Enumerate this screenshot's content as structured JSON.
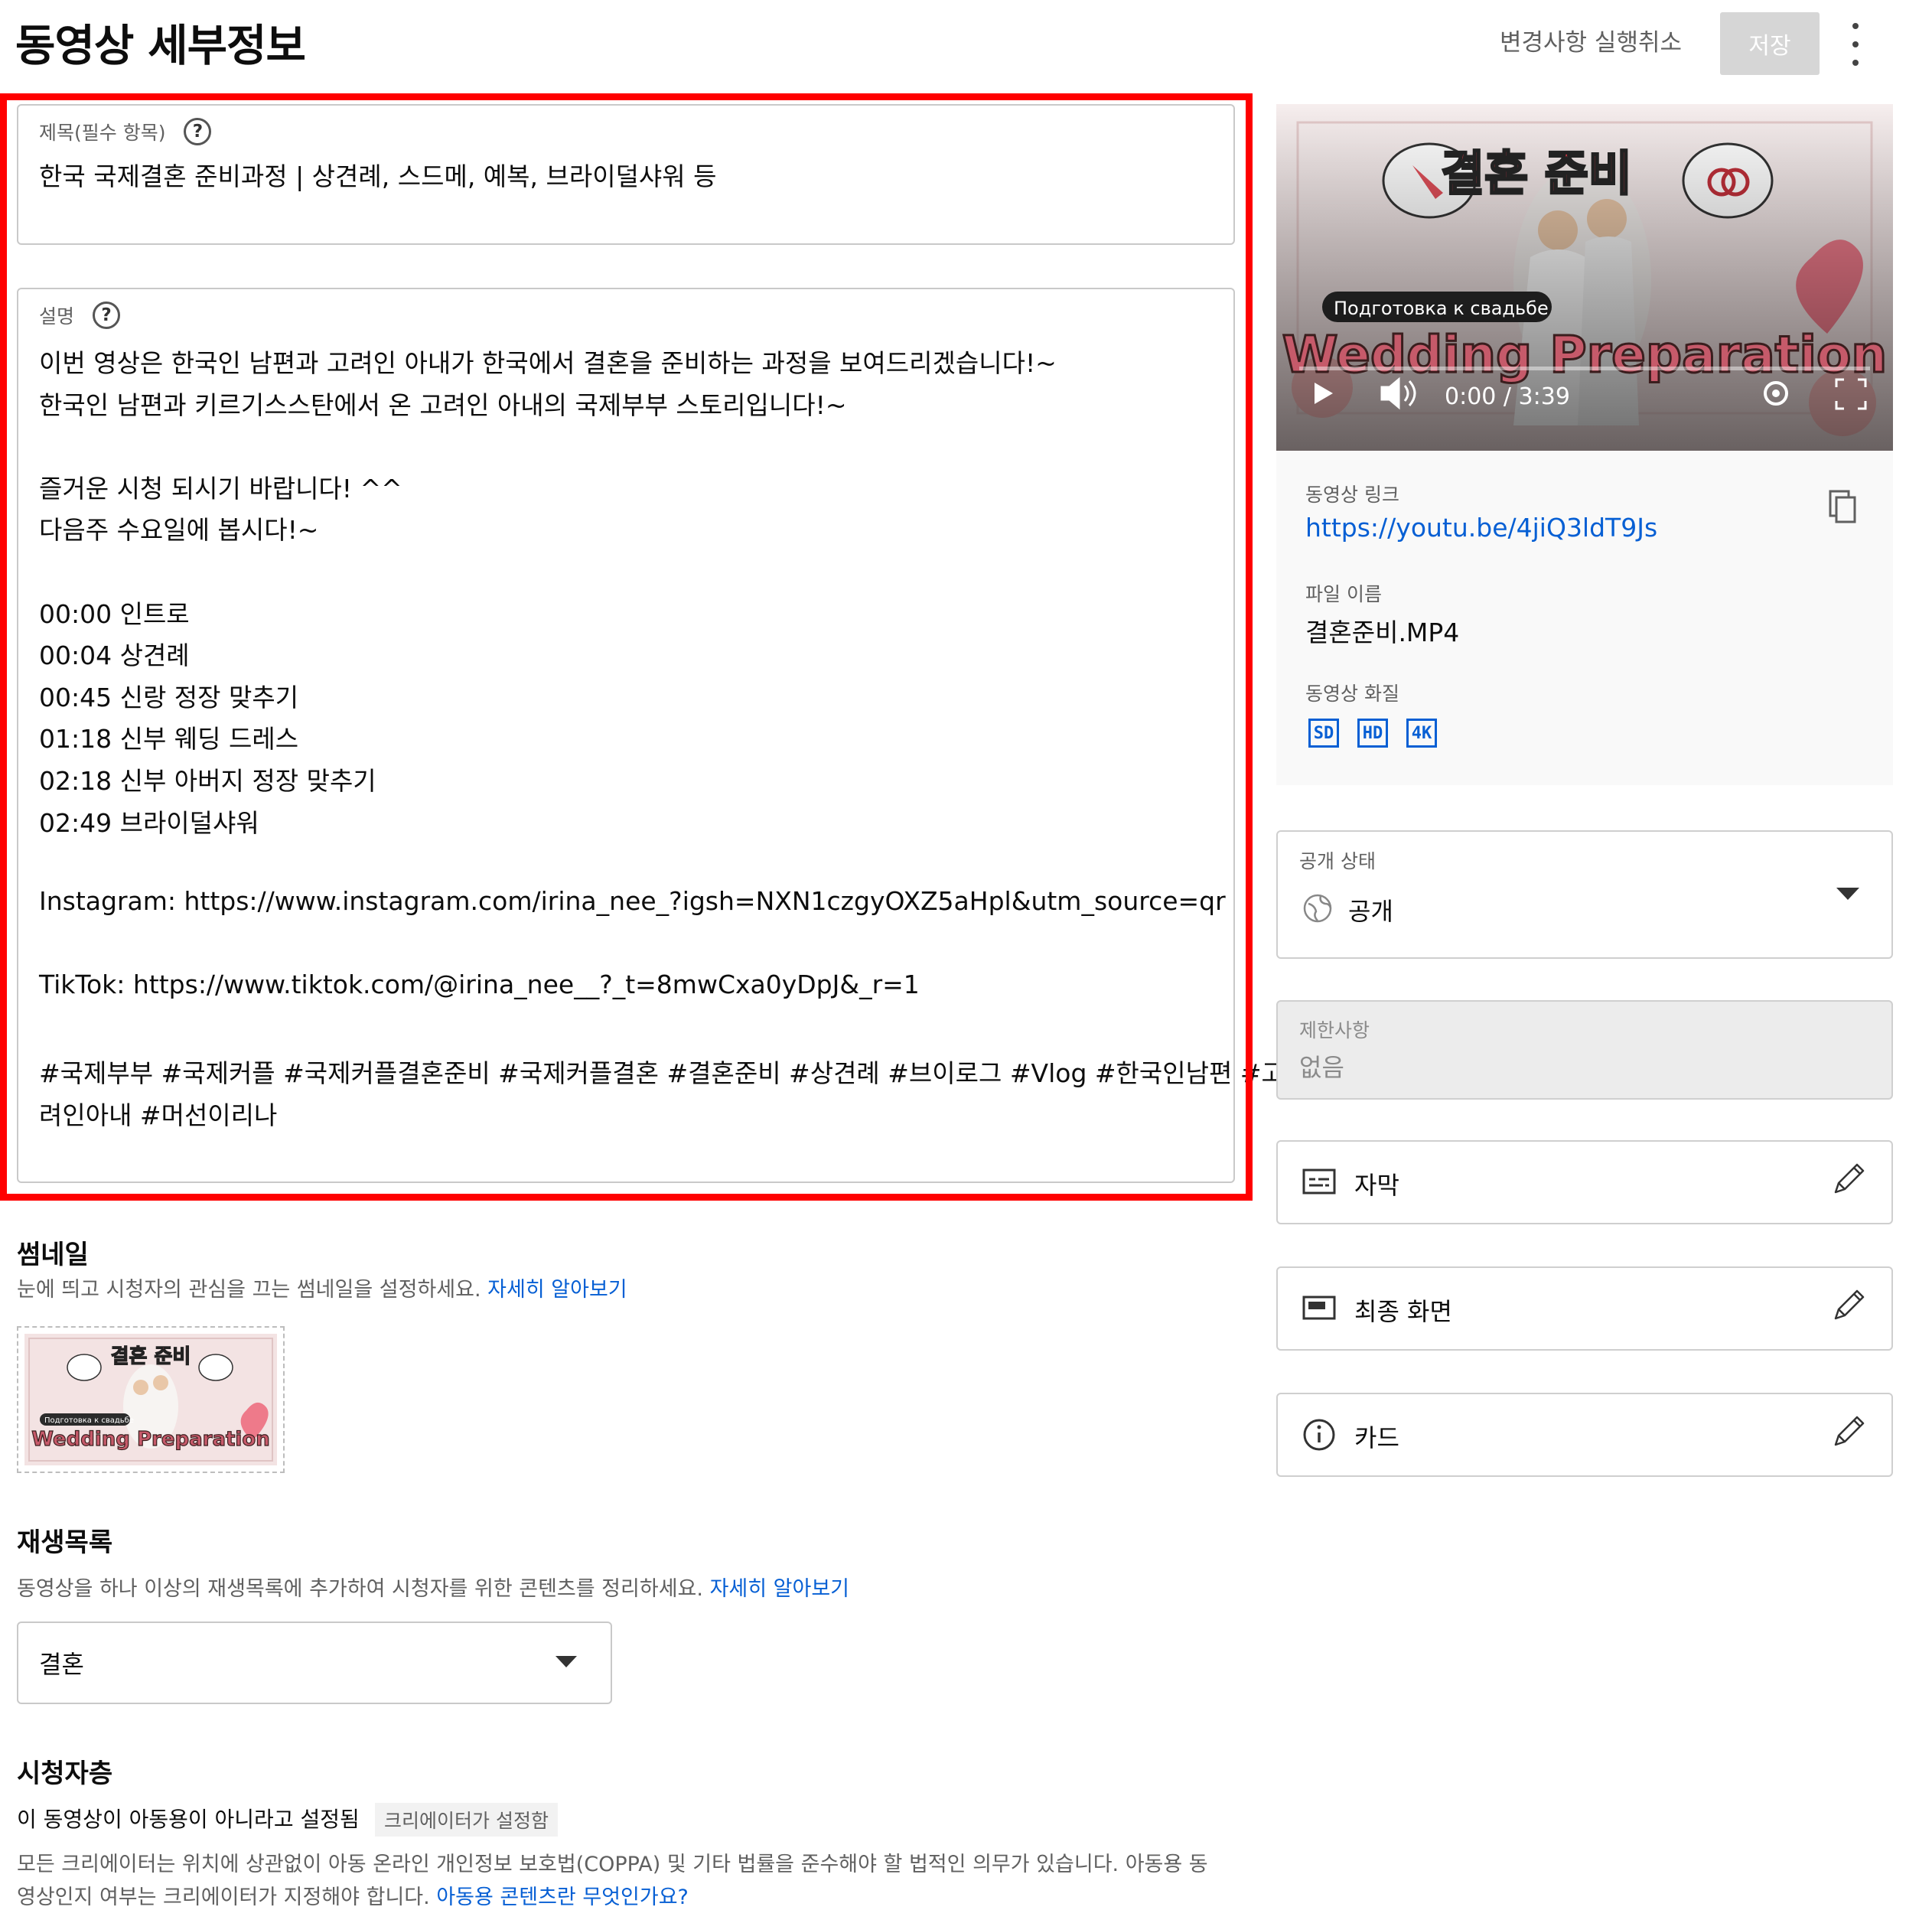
{
  "header": {
    "title": "동영상 세부정보",
    "undo_label": "변경사항 실행취소",
    "save_label": "저장"
  },
  "title_field": {
    "label": "제목(필수 항목)",
    "value": "한국 국제결혼 준비과정 | 상견례, 스드메, 예복, 브라이덜샤워 등"
  },
  "description_field": {
    "label": "설명",
    "lines": [
      "이번 영상은 한국인 남편과 고려인 아내가 한국에서 결혼을 준비하는 과정을 보여드리겠습니다!~",
      "한국인 남편과 키르기스스탄에서 온 고려인 아내의 국제부부 스토리입니다!~",
      "",
      "즐거운 시청 되시기 바랍니다! ^^",
      "다음주 수요일에 봅시다!~",
      "",
      "00:00 인트로",
      "00:04 상견례",
      "00:45 신랑 정장 맞추기",
      "01:18 신부 웨딩 드레스",
      "02:18 신부 아버지 정장 맞추기",
      "02:49 브라이덜샤워",
      "",
      "Instagram: https://www.instagram.com/irina_nee_?igsh=NXN1czgyOXZ5aHpl&utm_source=qr",
      "",
      "TikTok: https://www.tiktok.com/@irina_nee__?_t=8mwCxa0yDpJ&_r=1",
      "",
      "#국제부부 #국제커플 #국제커플결혼준비 #국제커플결혼 #결혼준비 #상견례 #브이로그 #Vlog #한국인남편 #고",
      "려인아내 #머선이리나"
    ]
  },
  "preview": {
    "title_korean": "결혼 준비",
    "subtitle_russian": "Подготовка к свадьбе",
    "title_english": "Wedding Preparation",
    "time_display": "0:00 / 3:39"
  },
  "video_info": {
    "link_label": "동영상 링크",
    "link_url": "https://youtu.be/4jiQ3ldT9Js",
    "filename_label": "파일 이름",
    "filename": "결혼준비.MP4",
    "quality_label": "동영상 화질",
    "qualities": [
      "SD",
      "HD",
      "4K"
    ]
  },
  "visibility": {
    "label": "공개 상태",
    "value": "공개"
  },
  "restrictions": {
    "label": "제한사항",
    "value": "없음"
  },
  "panels": {
    "subtitles": "자막",
    "end_screen": "최종 화면",
    "cards": "카드"
  },
  "thumbnail": {
    "title": "썸네일",
    "description": "눈에 띄고 시청자의 관심을 끄는 썸네일을 설정하세요.",
    "learn_more": "자세히 알아보기"
  },
  "playlist": {
    "title": "재생목록",
    "description": "동영상을 하나 이상의 재생목록에 추가하여 시청자를 위한 콘텐츠를 정리하세요.",
    "learn_more": "자세히 알아보기",
    "selected": "결혼"
  },
  "audience": {
    "title": "시청자층",
    "status": "이 동영상이 아동용이 아니라고 설정됨",
    "chip": "크리에이터가 설정함",
    "desc_line1": "모든 크리에이터는 위치에 상관없이 아동 온라인 개인정보 보호법(COPPA) 및 기타 법률을 준수해야 할 법적인 의무가 있습니다. 아동용 동",
    "desc_line2": "영상인지 여부는 크리에이터가 지정해야 합니다.",
    "link": "아동용 콘텐츠란 무엇인가요?"
  },
  "colors": {
    "link_blue": "#065fd4",
    "highlight_red": "#ff0000",
    "save_disabled": "#d6d6d6"
  }
}
